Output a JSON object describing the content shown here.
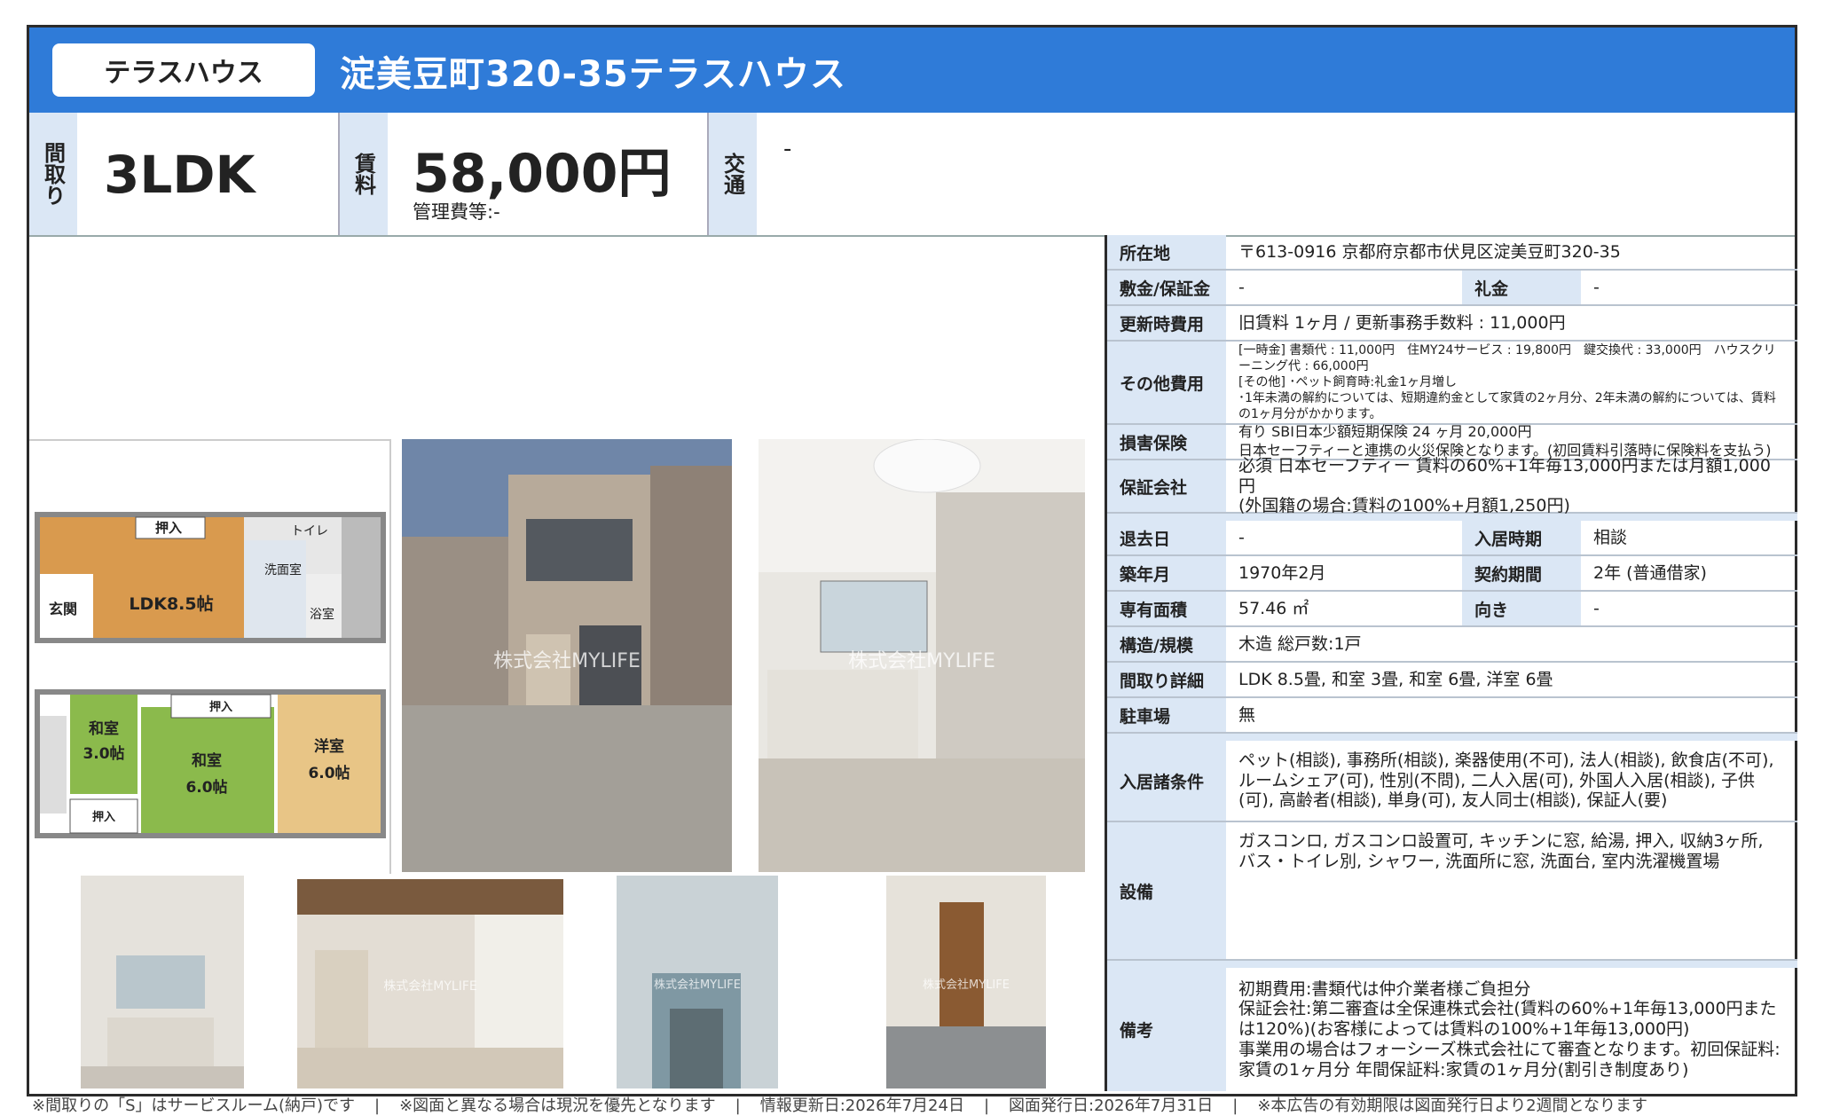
{
  "header": {
    "type_badge": "テラスハウス",
    "title": "淀美豆町320-35テラスハウス"
  },
  "summary": {
    "layout_label": "間取り",
    "layout_value": "3LDK",
    "rent_label": "賃料",
    "rent_value": "58,000円",
    "management_fee": "管理費等:-",
    "access_label": "交通",
    "access_value": "-"
  },
  "floorplan": {
    "rooms": [
      "押入",
      "トイレ",
      "洗面室",
      "玄関",
      "LDK8.5帖",
      "浴室",
      "和室",
      "3.0帖",
      "和室",
      "6.0帖",
      "洋室",
      "6.0帖",
      "押入",
      "押入"
    ]
  },
  "watermark": "株式会社MYLIFE",
  "details": {
    "address_label": "所在地",
    "address_value": "〒613-0916 京都府京都市伏見区淀美豆町320-35",
    "deposit_label": "敷金/保証金",
    "deposit_value": "-",
    "key_money_label": "礼金",
    "key_money_value": "-",
    "renewal_label": "更新時費用",
    "renewal_value": "旧賃料 1ヶ月 / 更新事務手数料 : 11,000円",
    "other_label": "その他費用",
    "other_value_1": "[一時金] 書類代 : 11,000円　住MY24サービス : 19,800円　鍵交換代 : 33,000円　ハウスクリーニング代 : 66,000円",
    "other_value_2": "[その他] ･ペット飼育時:礼金1ヶ月増し",
    "other_value_3": "･1年未満の解約については、短期違約金として家賃の2ヶ月分、2年未満の解約については、賃料の1ヶ月分がかかります。",
    "insurance_label": "損害保険",
    "insurance_value_1": "有り SBI日本少額短期保険 24 ヶ月 20,000円",
    "insurance_value_2": "日本セーフティーと連携の火災保険となります。(初回賃料引落時に保険料を支払う)",
    "guarantor_label": "保証会社",
    "guarantor_value_1": "必須 日本セーフティー 賃料の60%+1年毎13,000円または月額1,000円",
    "guarantor_value_2": "(外国籍の場合:賃料の100%+月額1,250円)",
    "vacate_label": "退去日",
    "vacate_value": "-",
    "move_in_label": "入居時期",
    "move_in_value": "相談",
    "built_label": "築年月",
    "built_value": "1970年2月",
    "contract_label": "契約期間",
    "contract_value": "2年 (普通借家)",
    "area_label": "専有面積",
    "area_value": "57.46 ㎡",
    "direction_label": "向き",
    "direction_value": "-",
    "structure_label": "構造/規模",
    "structure_value": "木造 総戸数:1戸",
    "layout_detail_label": "間取り詳細",
    "layout_detail_value": "LDK 8.5畳, 和室 3畳, 和室 6畳, 洋室 6畳",
    "parking_label": "駐車場",
    "parking_value": "無",
    "conditions_label": "入居諸条件",
    "conditions_value": "ペット(相談), 事務所(相談), 楽器使用(不可), 法人(相談), 飲食店(不可), ルームシェア(可), 性別(不問), 二人入居(可), 外国人入居(相談), 子供(可), 高齢者(相談), 単身(可), 友人同士(相談), 保証人(要)",
    "equipment_label": "設備",
    "equipment_value": "ガスコンロ, ガスコンロ設置可, キッチンに窓, 給湯, 押入, 収納3ヶ所, バス・トイレ別, シャワー, 洗面所に窓, 洗面台, 室内洗濯機置場",
    "remarks_label": "備考",
    "remarks_value_1": "初期費用:書類代は仲介業者様ご負担分",
    "remarks_value_2": "保証会社:第二審査は全保連株式会社(賃料の60%+1年毎13,000円または120%)(お客様によっては賃料の100%+1年毎13,000円)",
    "remarks_value_3": "事業用の場合はフォーシーズ株式会社にて審査となります。初回保証料:家賃の1ヶ月分 年間保証料:家賃の1ヶ月分(割引き制度あり)"
  },
  "footer": {
    "note_1": "※間取りの「S」はサービスルーム(納戸)です",
    "note_2": "※図面と異なる場合は現況を優先となります",
    "note_3": "情報更新日:2026年7月24日",
    "note_4": "図面発行日:2026年7月31日",
    "note_5": "※本広告の有効期限は図面発行日より2週間となります",
    "separator": "|"
  }
}
